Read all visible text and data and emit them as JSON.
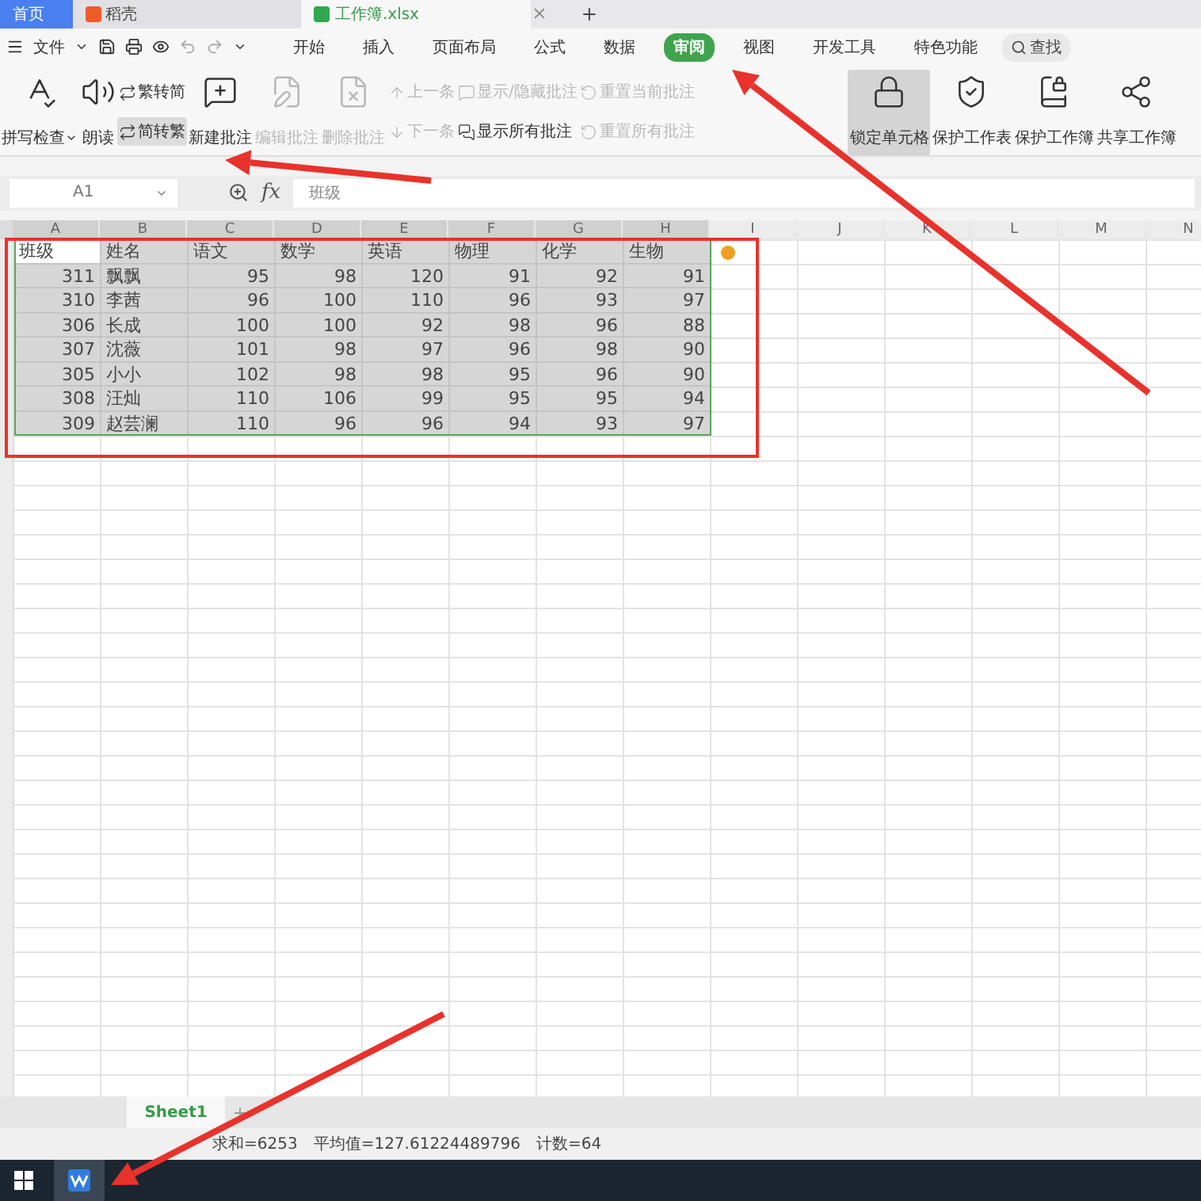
{
  "tabs": [
    {
      "label": "首页",
      "kind": "home",
      "selected": false
    },
    {
      "label": "稻壳",
      "kind": "docer",
      "selected": false
    },
    {
      "label": "工作簿.xlsx",
      "kind": "sheet",
      "selected": true
    }
  ],
  "menu": {
    "file": "文件",
    "search": "查找",
    "tabs": [
      {
        "label": "开始",
        "selected": false
      },
      {
        "label": "插入",
        "selected": false
      },
      {
        "label": "页面布局",
        "selected": false
      },
      {
        "label": "公式",
        "selected": false
      },
      {
        "label": "数据",
        "selected": false
      },
      {
        "label": "审阅",
        "selected": true
      },
      {
        "label": "视图",
        "selected": false
      },
      {
        "label": "开发工具",
        "selected": false
      },
      {
        "label": "特色功能",
        "selected": false
      }
    ]
  },
  "ribbon": [
    {
      "kind": "large",
      "label": "拼写检查",
      "dropdown": true,
      "disabled": false,
      "selected": false
    },
    {
      "kind": "large",
      "label": "朗读",
      "dropdown": false,
      "disabled": false,
      "selected": false
    },
    {
      "kind": "stack",
      "items": [
        {
          "label": "繁转简",
          "disabled": false,
          "selected": false
        },
        {
          "label": "简转繁",
          "disabled": false,
          "selected": true
        }
      ]
    },
    {
      "kind": "large",
      "label": "新建批注",
      "dropdown": false,
      "disabled": false,
      "selected": false
    },
    {
      "kind": "large",
      "label": "编辑批注",
      "dropdown": false,
      "disabled": true,
      "selected": false
    },
    {
      "kind": "large",
      "label": "删除批注",
      "dropdown": false,
      "disabled": true,
      "selected": false
    },
    {
      "kind": "stack",
      "items": [
        {
          "label": "上一条",
          "disabled": true,
          "selected": false
        },
        {
          "label": "下一条",
          "disabled": true,
          "selected": false
        }
      ]
    },
    {
      "kind": "stack",
      "items": [
        {
          "label": "显示/隐藏批注",
          "disabled": true,
          "selected": false
        },
        {
          "label": "显示所有批注",
          "disabled": false,
          "selected": false
        }
      ]
    },
    {
      "kind": "stack",
      "items": [
        {
          "label": "重置当前批注",
          "disabled": true,
          "selected": false
        },
        {
          "label": "重置所有批注",
          "disabled": true,
          "selected": false
        }
      ]
    },
    {
      "kind": "large",
      "label": "锁定单元格",
      "dropdown": false,
      "disabled": false,
      "selected": true
    },
    {
      "kind": "large",
      "label": "保护工作表",
      "dropdown": false,
      "disabled": false,
      "selected": false
    },
    {
      "kind": "large",
      "label": "保护工作簿",
      "dropdown": false,
      "disabled": false,
      "selected": false
    },
    {
      "kind": "large",
      "label": "共享工作簿",
      "dropdown": false,
      "disabled": false,
      "selected": false
    }
  ],
  "formula_bar": {
    "cell": "A1",
    "function_label": "fx",
    "value": "班级"
  },
  "columns": [
    "A",
    "B",
    "C",
    "D",
    "E",
    "F",
    "G",
    "H",
    "I",
    "J",
    "K",
    "L",
    "M",
    "N"
  ],
  "table": {
    "header": [
      "班级",
      "姓名",
      "语文",
      "数学",
      "英语",
      "物理",
      "化学",
      "生物"
    ],
    "rows": [
      [
        "311",
        "飘飘",
        "95",
        "98",
        "120",
        "91",
        "92",
        "91"
      ],
      [
        "310",
        "李茜",
        "96",
        "100",
        "110",
        "96",
        "93",
        "97"
      ],
      [
        "306",
        "长成",
        "100",
        "100",
        "92",
        "98",
        "96",
        "88"
      ],
      [
        "307",
        "沈薇",
        "101",
        "98",
        "97",
        "96",
        "98",
        "90"
      ],
      [
        "305",
        "小小",
        "102",
        "98",
        "98",
        "95",
        "96",
        "90"
      ],
      [
        "308",
        "汪灿",
        "110",
        "106",
        "99",
        "95",
        "95",
        "94"
      ],
      [
        "309",
        "赵芸澜",
        "110",
        "96",
        "96",
        "94",
        "93",
        "97"
      ]
    ]
  },
  "sheet_tabs": [
    {
      "label": "Sheet1",
      "selected": true
    }
  ],
  "status": [
    "求和=6253",
    "平均值=127.61224489796",
    "计数=64"
  ]
}
